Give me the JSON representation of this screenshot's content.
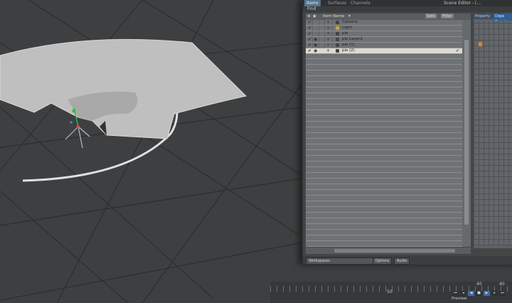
{
  "scene_editor": {
    "tabs": [
      "Items",
      "Surfaces",
      "Channels"
    ],
    "title": "Scene Editor - (…",
    "find_label": "Find",
    "header": {
      "item": "Item",
      "name": "Name",
      "sets": "Sets",
      "filter": "Filter"
    },
    "items": [
      {
        "name": "Camera",
        "checked": true,
        "icon": "camera-icon"
      },
      {
        "name": "Light",
        "checked": true,
        "icon": "light-icon"
      },
      {
        "name": "pie",
        "checked": true,
        "icon": "mesh-icon"
      },
      {
        "name": "pie Layer2",
        "checked": true,
        "icon": "mesh-icon"
      },
      {
        "name": "pie (1)",
        "checked": true,
        "icon": "mesh-icon"
      },
      {
        "name": "pie (2)",
        "checked": true,
        "icon": "mesh-icon",
        "selected": true
      }
    ],
    "bottom": {
      "workspaces": "Workspaces",
      "options": "Options",
      "audio": "Audio"
    },
    "property_tabs": [
      "Property",
      "Dope Sheet"
    ]
  },
  "timeline": {
    "ruler_labels": [
      "50",
      "40",
      "40"
    ],
    "preview_label": "Preview"
  },
  "colors": {
    "viewport": "#3d3f40",
    "selection_accent": "#d8842e",
    "active_tab": "#55738f"
  }
}
